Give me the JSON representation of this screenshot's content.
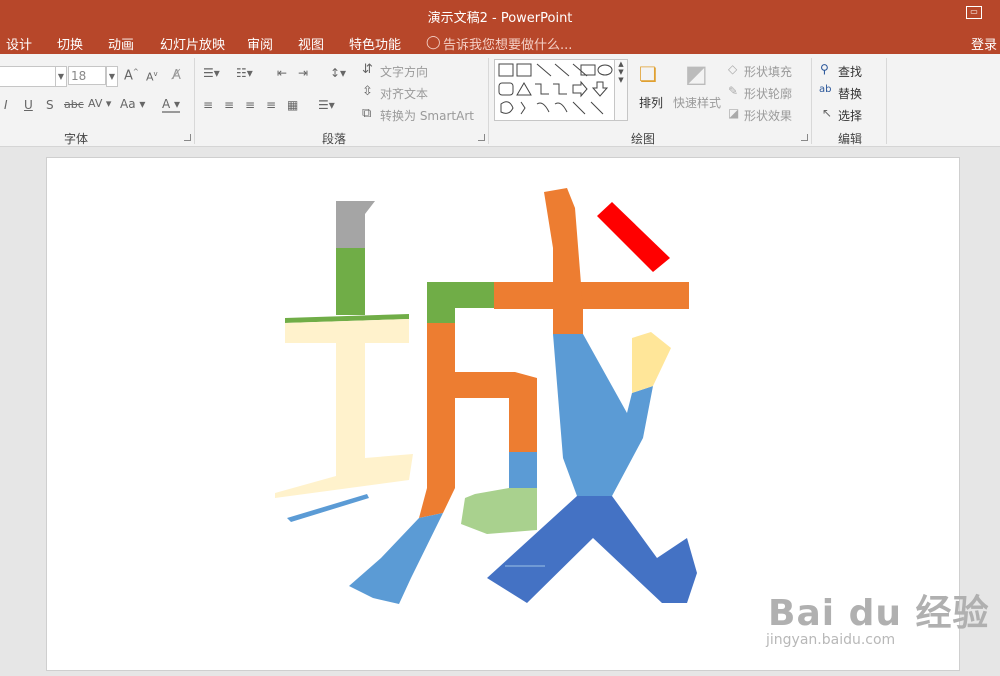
{
  "titlebar": {
    "title": "演示文稿2 - PowerPoint"
  },
  "tabs": [
    "设计",
    "切换",
    "动画",
    "幻灯片放映",
    "审阅",
    "视图",
    "特色功能"
  ],
  "tellme": "告诉我您想要做什么...",
  "signin": "登录",
  "font": {
    "size": "18",
    "group_label": "字体"
  },
  "paragraph": {
    "text_direction": "文字方向",
    "align_text": "对齐文本",
    "smartart": "转换为 SmartArt",
    "group_label": "段落"
  },
  "drawing": {
    "arrange": "排列",
    "quick_styles": "快速样式",
    "fill": "形状填充",
    "outline": "形状轮廓",
    "effects": "形状效果",
    "group_label": "绘图"
  },
  "editing": {
    "find": "查找",
    "replace": "替换",
    "select": "选择",
    "group_label": "编辑"
  },
  "slide": {
    "colors": {
      "gray": "#a5a5a5",
      "green": "#70ad47",
      "cream": "#fff2cc",
      "orange": "#ed7d31",
      "blue": "#5b9bd5",
      "darkblue": "#4472c4",
      "lightgreen": "#a9d18e",
      "yellow": "#ffe699",
      "red": "#ff0000"
    }
  },
  "watermark": {
    "logo": "Bai du 经验",
    "url": "jingyan.baidu.com"
  }
}
